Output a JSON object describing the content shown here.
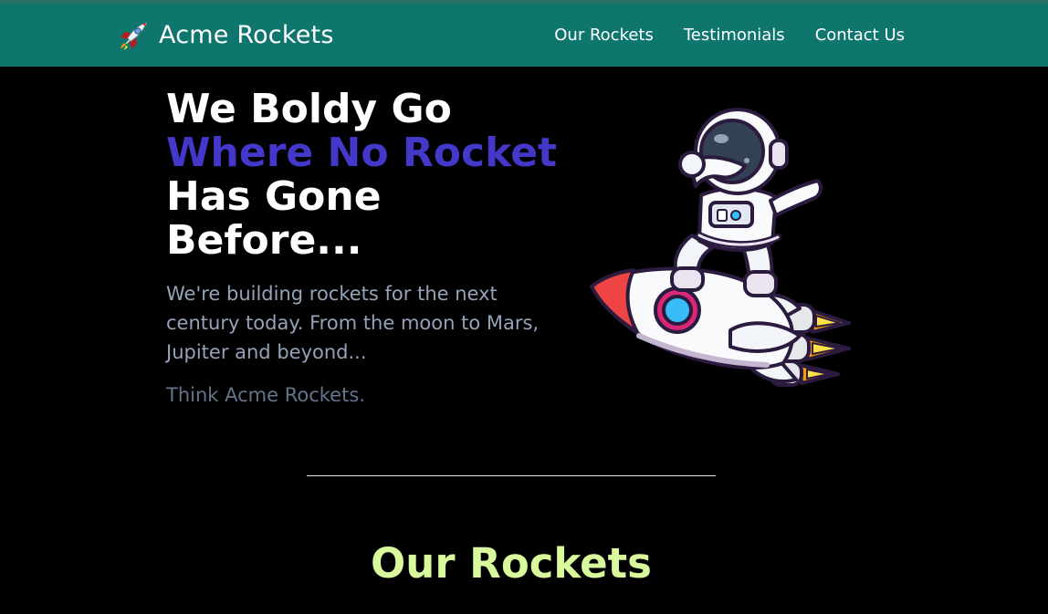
{
  "brand": {
    "icon": "rocket-icon",
    "name": "Acme Rockets"
  },
  "nav": {
    "items": [
      {
        "label": "Our Rockets"
      },
      {
        "label": "Testimonials"
      },
      {
        "label": "Contact Us"
      }
    ]
  },
  "hero": {
    "title_line1": "We Boldy Go",
    "title_accent": "Where No Rocket",
    "title_line3": "Has Gone",
    "title_line4": "Before...",
    "description": "We're building rockets for the next century today. From the moon to Mars, Jupiter and beyond...",
    "tagline": "Think Acme Rockets.",
    "illustration": "astronaut-riding-rocket-illustration"
  },
  "rockets_section": {
    "title": "Our Rockets"
  },
  "colors": {
    "navbar": "#0f766e",
    "background": "#000000",
    "accent": "#4338ca",
    "section_title": "#d9f99d",
    "description_text": "#94a3b8",
    "tagline_text": "#64748b"
  }
}
